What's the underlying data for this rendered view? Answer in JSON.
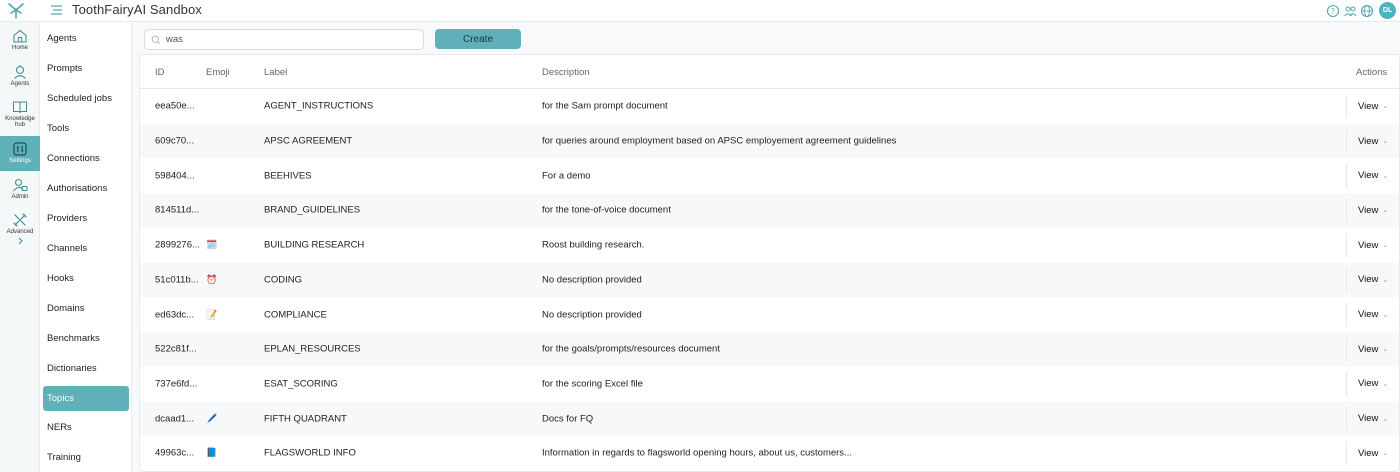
{
  "app": {
    "title": "ToothFairyAI Sandbox",
    "avatar_initials": "DL",
    "accent": "#5fb0b9"
  },
  "rail": [
    {
      "label": "Home",
      "icon": "home-icon"
    },
    {
      "label": "Agents",
      "icon": "agents-icon"
    },
    {
      "label": "Knowledge hub",
      "icon": "book-icon"
    },
    {
      "label": "Settings",
      "icon": "settings-icon",
      "active": true
    },
    {
      "label": "Admin",
      "icon": "admin-icon"
    },
    {
      "label": "Advanced",
      "icon": "advanced-icon"
    }
  ],
  "menu": {
    "items": [
      "Agents",
      "Prompts",
      "Scheduled jobs",
      "Tools",
      "Connections",
      "Authorisations",
      "Providers",
      "Channels",
      "Hooks",
      "Domains",
      "Benchmarks",
      "Dictionaries",
      "Topics",
      "NERs",
      "Training"
    ],
    "active": "Topics"
  },
  "search": {
    "value": "was"
  },
  "create_label": "Create",
  "table": {
    "headers": {
      "id": "ID",
      "emoji": "Emoji",
      "label": "Label",
      "description": "Description",
      "actions": "Actions"
    },
    "view_label": "View",
    "rows": [
      {
        "id": "eea50e...",
        "emoji": "",
        "label": "AGENT_INSTRUCTIONS",
        "description": "for the Sam prompt document"
      },
      {
        "id": "609c70...",
        "emoji": "",
        "label": "APSC AGREEMENT",
        "description": "for queries around employment based on APSC employement agreement guidelines"
      },
      {
        "id": "598404...",
        "emoji": "",
        "label": "BEEHIVES",
        "description": "For a demo"
      },
      {
        "id": "814511d...",
        "emoji": "",
        "label": "BRAND_GUIDELINES",
        "description": "for the tone-of-voice document"
      },
      {
        "id": "2899276...",
        "emoji": "🗓️",
        "label": "BUILDING RESEARCH",
        "description": "Roost building research."
      },
      {
        "id": "51c011b...",
        "emoji": "⏰",
        "label": "CODING",
        "description": "No description provided"
      },
      {
        "id": "ed63dc...",
        "emoji": "📝",
        "label": "COMPLIANCE",
        "description": "No description provided"
      },
      {
        "id": "522c81f...",
        "emoji": "",
        "label": "EPLAN_RESOURCES",
        "description": "for the goals/prompts/resources document"
      },
      {
        "id": "737e6fd...",
        "emoji": "",
        "label": "ESAT_SCORING",
        "description": "for the scoring Excel file"
      },
      {
        "id": "dcaad1...",
        "emoji": "🖊️",
        "label": "FIFTH QUADRANT",
        "description": "Docs for FQ"
      },
      {
        "id": "49963c...",
        "emoji": "📘",
        "label": "FLAGSWORLD INFO",
        "description": "Information in regards to flagsworld opening hours, about us, customers..."
      }
    ]
  }
}
